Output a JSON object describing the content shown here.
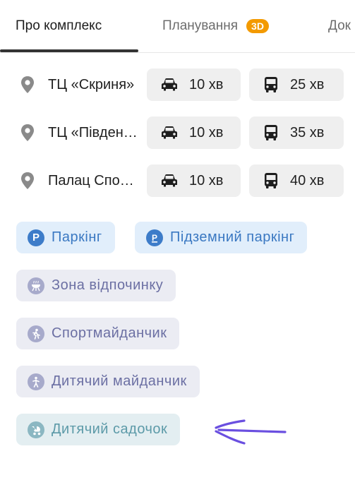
{
  "tabs": [
    {
      "label": "Про комплекс",
      "active": true
    },
    {
      "label": "Планування",
      "badge": "3D"
    },
    {
      "label": "Док"
    }
  ],
  "places": [
    {
      "name": "ТЦ «Скриня»",
      "car_time": "10 хв",
      "bus_time": "25 хв"
    },
    {
      "name": "ТЦ «Півден…",
      "car_time": "10 хв",
      "bus_time": "35 хв"
    },
    {
      "name": "Палац Спо…",
      "car_time": "10 хв",
      "bus_time": "40 хв"
    }
  ],
  "amenities": [
    {
      "label": "Паркінг",
      "icon": "parking-icon",
      "style": "blue"
    },
    {
      "label": "Підземний паркінг",
      "icon": "underground-parking-icon",
      "style": "blue"
    },
    {
      "label": "Зона відпочинку",
      "icon": "grill-icon",
      "style": "grey"
    },
    {
      "label": "Спортмайданчик",
      "icon": "sport-icon",
      "style": "grey"
    },
    {
      "label": "Дитячий майданчик",
      "icon": "playground-icon",
      "style": "grey"
    },
    {
      "label": "Дитячий садочок",
      "icon": "stroller-icon",
      "style": "teal"
    }
  ],
  "colors": {
    "badge": "#f39a00",
    "blue_chip_bg": "#e1eefb",
    "blue_chip_text": "#3a78c2",
    "grey_chip_bg": "#ebecf3",
    "grey_chip_text": "#6b6fa3",
    "teal_chip_bg": "#e3eef1",
    "teal_chip_text": "#5c9aa8",
    "annotation_arrow": "#6a4fe0"
  }
}
